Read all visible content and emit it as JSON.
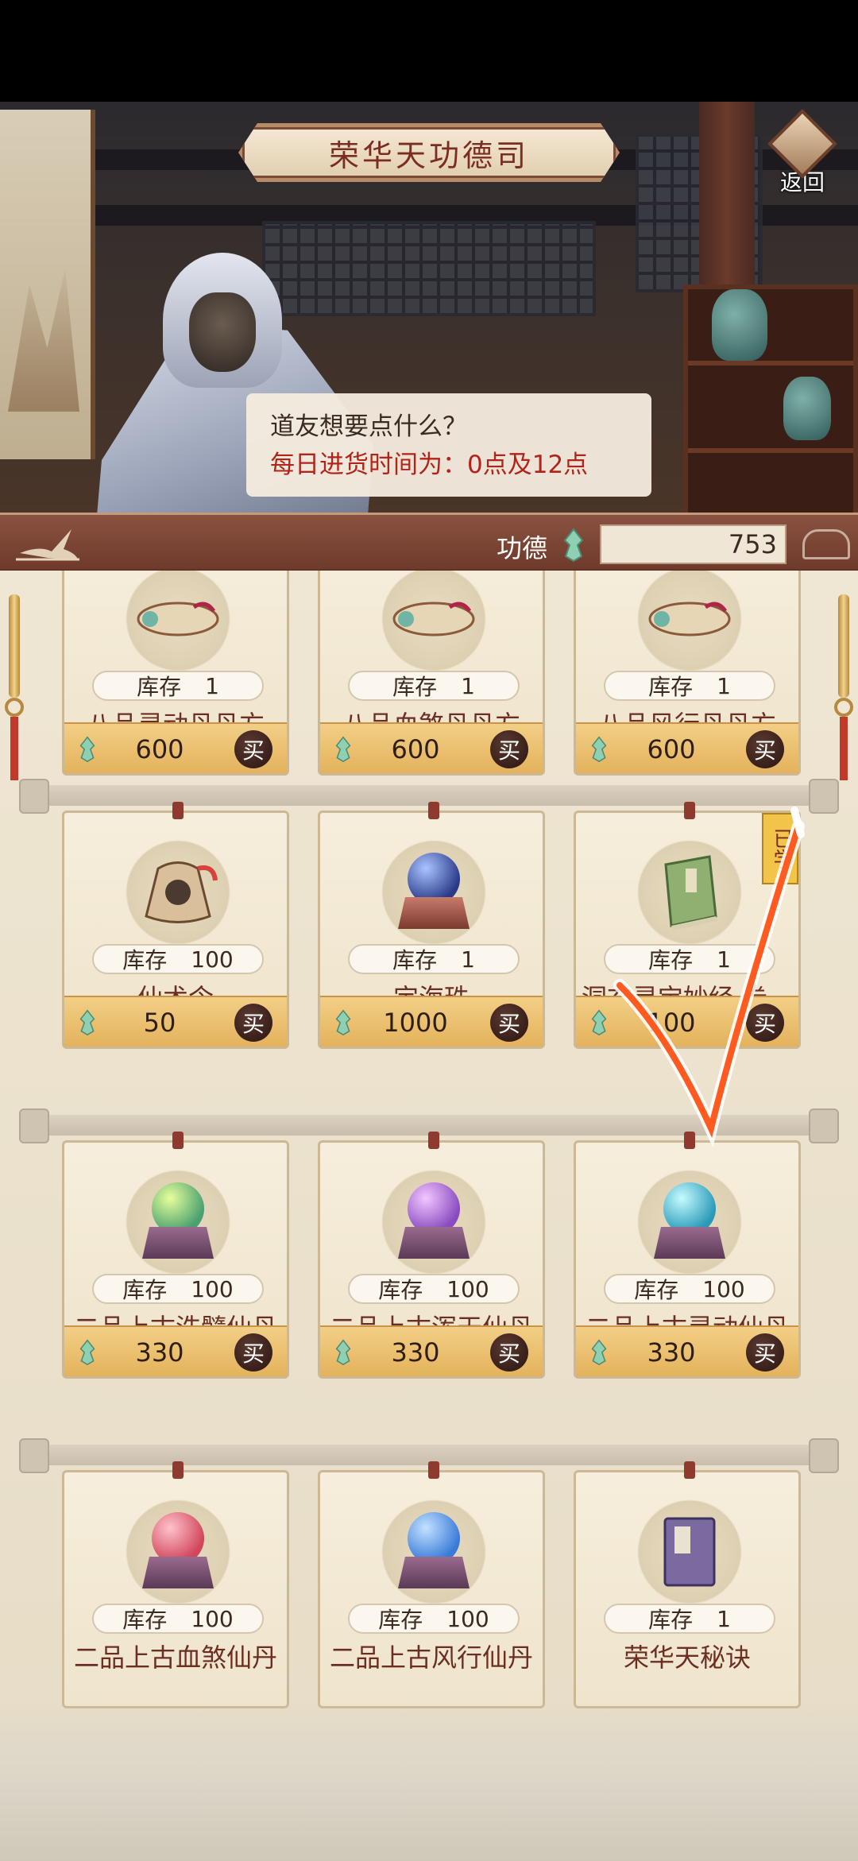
{
  "header": {
    "title": "荣华天功德司",
    "back_label": "返回"
  },
  "dialog": {
    "line1": "道友想要点什么？",
    "line2": "每日进货时间为：0点及12点"
  },
  "merit": {
    "label": "功德",
    "value": "753"
  },
  "shop": {
    "stock_label": "库存",
    "buy_label": "买",
    "learned_label": "已学",
    "rows": [
      [
        {
          "name": "八品灵动丹丹方",
          "stock": "1",
          "price": "600"
        },
        {
          "name": "八品血煞丹丹方",
          "stock": "1",
          "price": "600"
        },
        {
          "name": "八品风行丹丹方",
          "stock": "1",
          "price": "600"
        }
      ],
      [
        {
          "name": "仙术令",
          "stock": "100",
          "price": "50"
        },
        {
          "name": "定海珠",
          "stock": "1",
          "price": "1000"
        },
        {
          "name": "洞玄灵宝妙经·卷一",
          "stock": "1",
          "price": "100"
        }
      ],
      [
        {
          "name": "二品上古洗髓仙丹",
          "stock": "100",
          "price": "330"
        },
        {
          "name": "二品上古浑天仙丹",
          "stock": "100",
          "price": "330"
        },
        {
          "name": "二品上古灵动仙丹",
          "stock": "100",
          "price": "330"
        }
      ],
      [
        {
          "name": "二品上古血煞仙丹",
          "stock": "100"
        },
        {
          "name": "二品上古风行仙丹",
          "stock": "100"
        },
        {
          "name": "荣华天秘诀",
          "stock": "1"
        }
      ]
    ]
  },
  "colors": {
    "accent_red": "#b0241a",
    "title_red": "#7a2e22",
    "price_gold": "#e4b25c",
    "annotation_orange": "#ff5a1f"
  }
}
